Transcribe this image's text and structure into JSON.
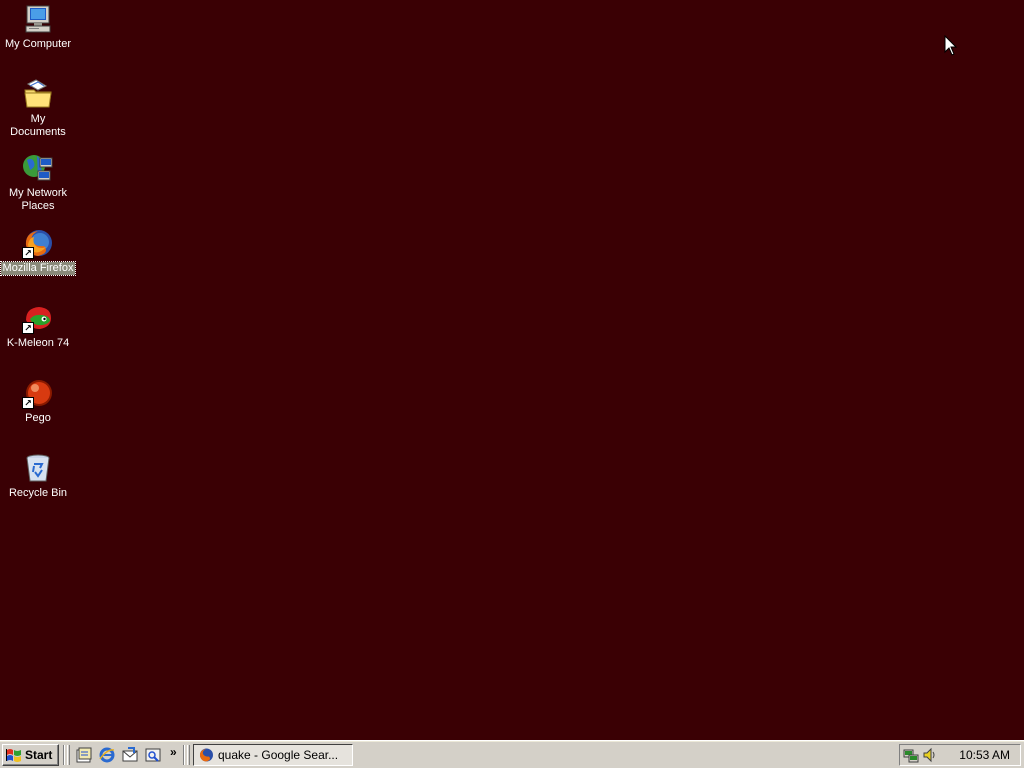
{
  "desktop": {
    "background": "#3a0004",
    "icons": [
      {
        "label": "My Computer",
        "icon": "my-computer-icon"
      },
      {
        "label": "My Documents",
        "icon": "my-documents-icon"
      },
      {
        "label": "My Network Places",
        "icon": "network-places-icon"
      },
      {
        "label": "Mozilla Firefox",
        "icon": "firefox-icon",
        "shortcut": true,
        "selected": true
      },
      {
        "label": "K-Meleon 74",
        "icon": "k-meleon-icon",
        "shortcut": true
      },
      {
        "label": "Pego",
        "icon": "pego-icon",
        "shortcut": true
      },
      {
        "label": "Recycle Bin",
        "icon": "recycle-bin-icon"
      }
    ]
  },
  "taskbar": {
    "start_label": "Start",
    "quick_launch": [
      "show-desktop-icon",
      "internet-explorer-icon",
      "outlook-express-icon",
      "media-icon"
    ],
    "quick_launch_more": "»",
    "task_label": "quake - Google Sear...",
    "tray_icons": [
      "network-tray-icon",
      "volume-tray-icon"
    ],
    "clock": "10:53 AM"
  }
}
